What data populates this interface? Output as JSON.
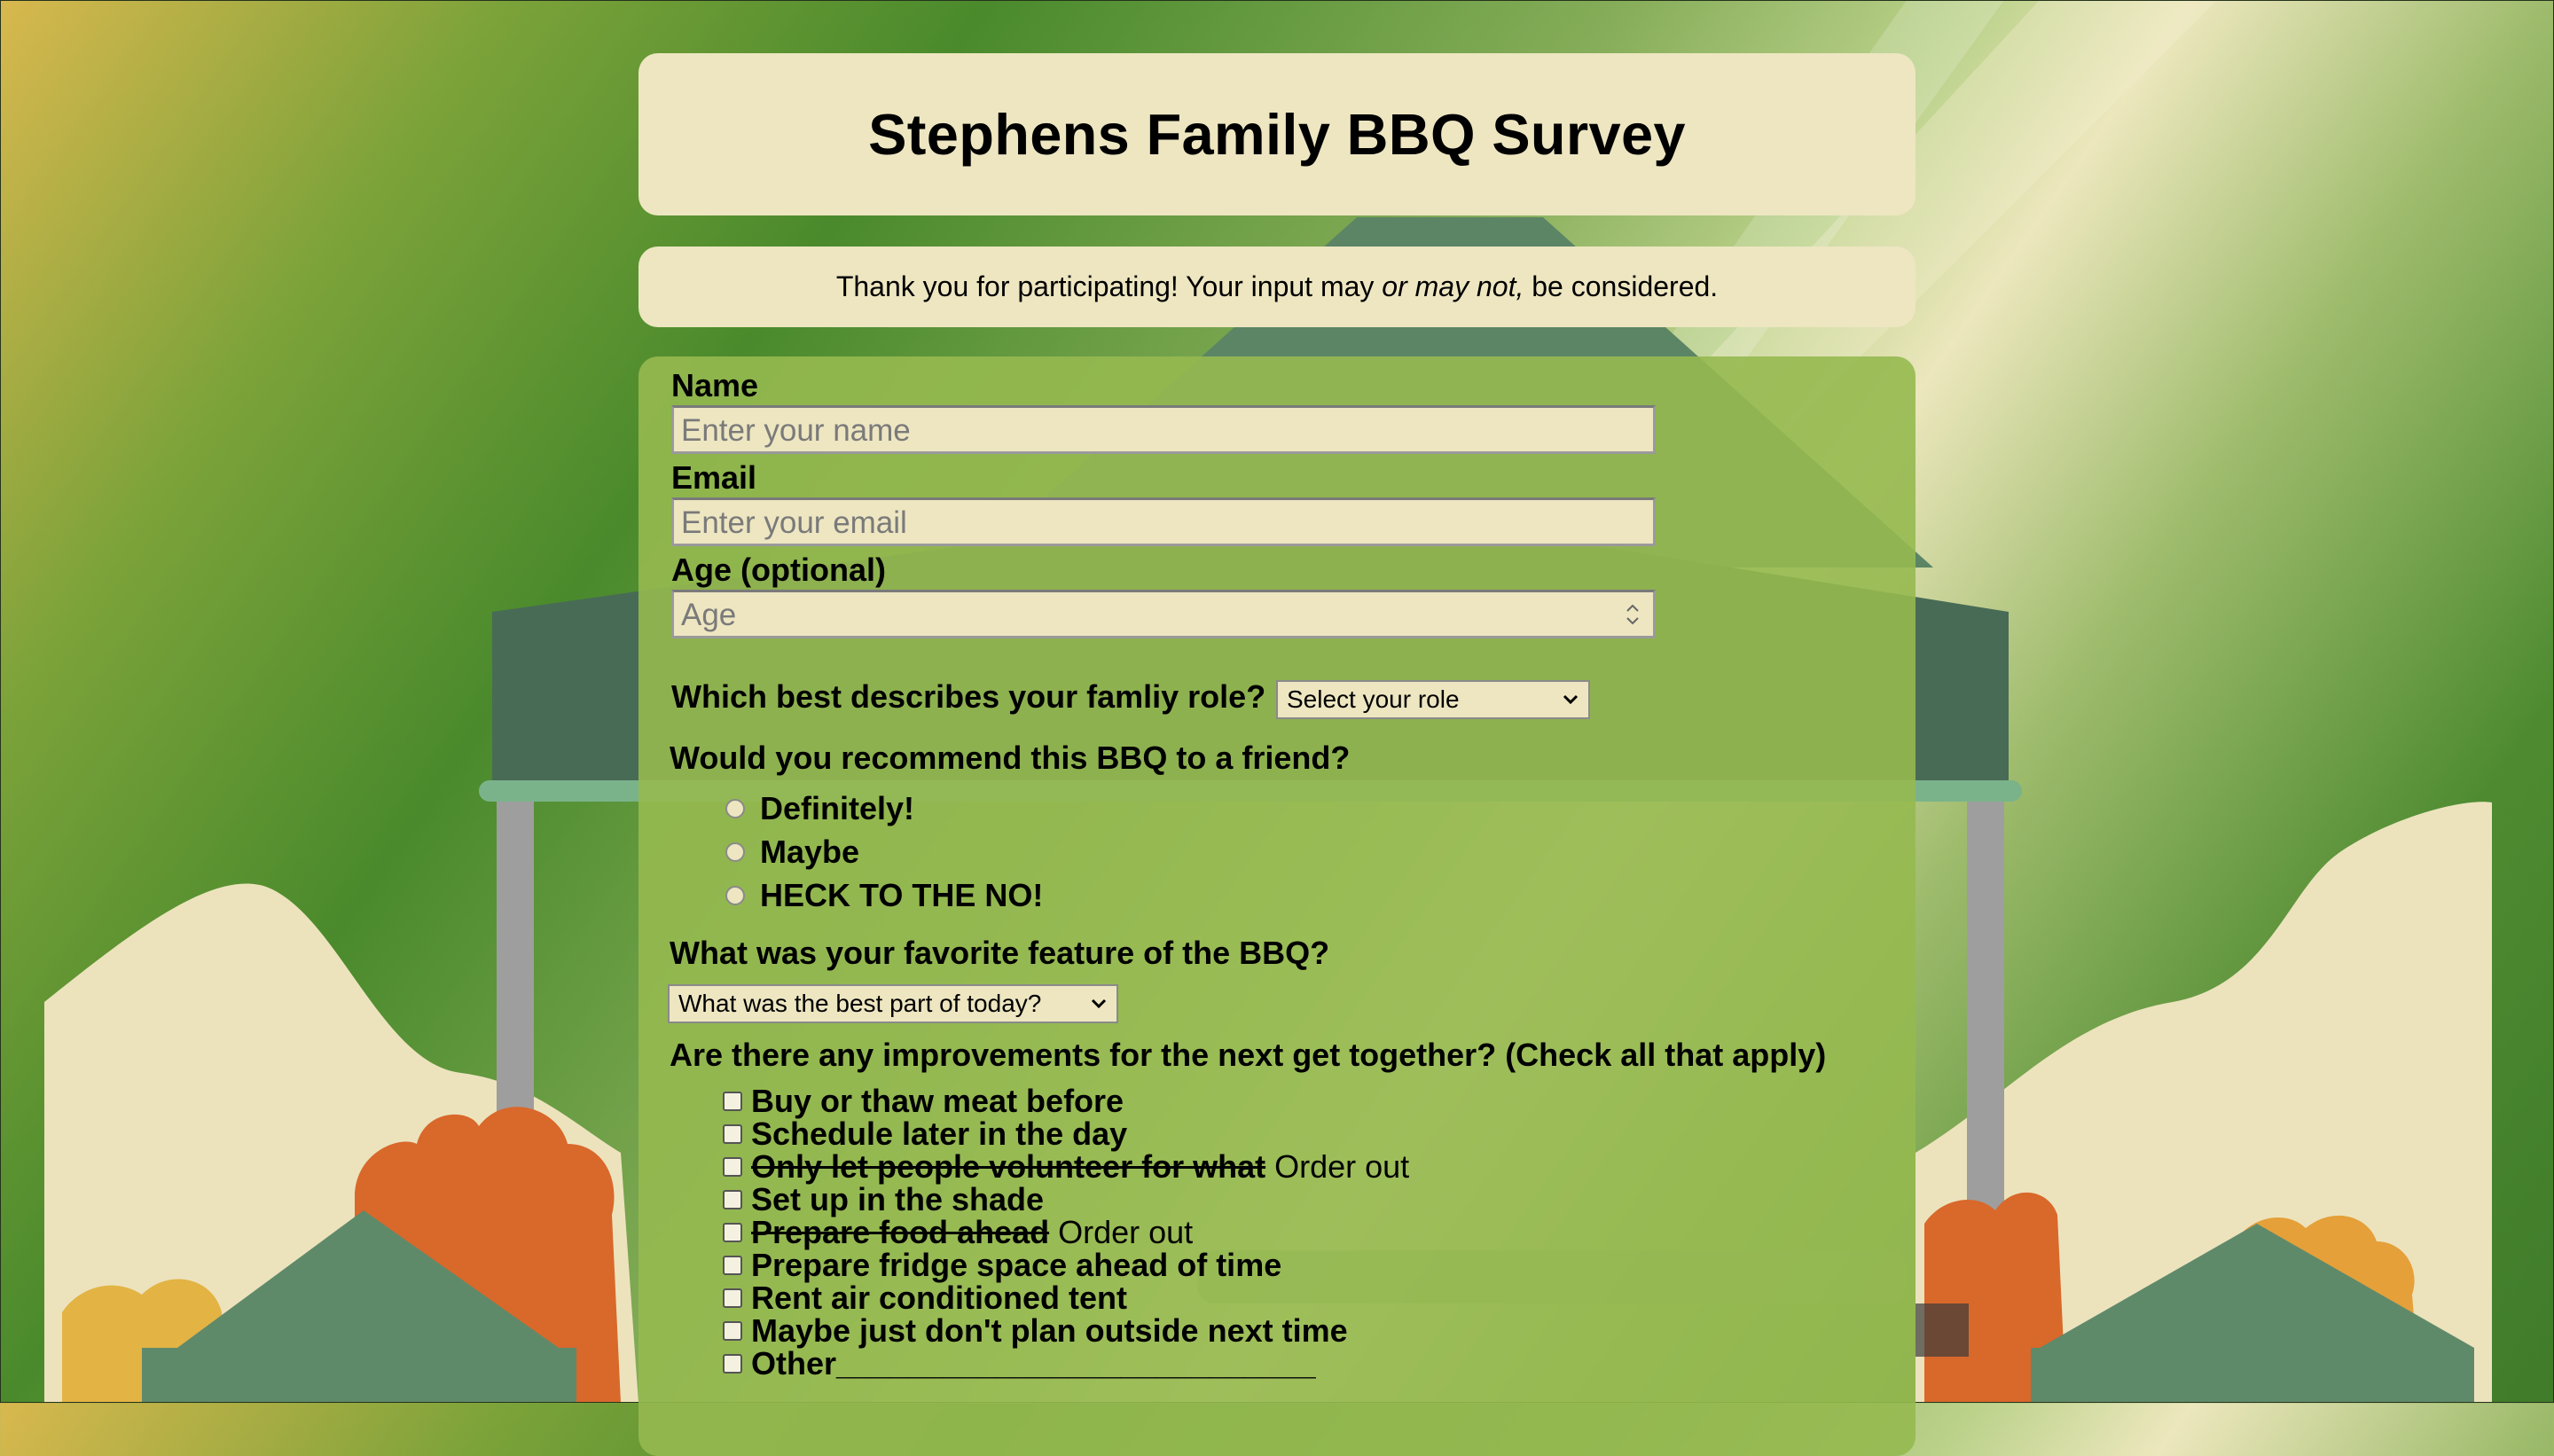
{
  "title": "Stephens Family BBQ Survey",
  "intro": {
    "before": "Thank you for participating! Your input may",
    "emphasis": "or may not,",
    "after": "be considered."
  },
  "form": {
    "name": {
      "label": "Name",
      "placeholder": "Enter your name"
    },
    "email": {
      "label": "Email",
      "placeholder": "Enter your email"
    },
    "age": {
      "label": "Age (optional)",
      "placeholder": "Age"
    },
    "role": {
      "question": "Which best describes your famliy role?",
      "selected": "Select your role"
    },
    "recommend": {
      "question": "Would you recommend this BBQ to a friend?",
      "options": [
        "Definitely!",
        "Maybe",
        "HECK TO THE NO!"
      ]
    },
    "favorite": {
      "question": "What was your favorite feature of the BBQ?",
      "selected": "What was the best part of today?"
    },
    "improvements": {
      "question": "Are there any improvements for the next get together? (Check all that apply)",
      "options": [
        {
          "label": "Buy or thaw meat before"
        },
        {
          "label": "Schedule later in the day"
        },
        {
          "struck": "Only let people volunteer for what",
          "tail": "Order out"
        },
        {
          "label": "Set up in the shade"
        },
        {
          "struck": "Prepare food ahead",
          "tail": "Order out"
        },
        {
          "label": "Prepare fridge space ahead of time"
        },
        {
          "label": "Rent air conditioned tent"
        },
        {
          "label": "Maybe just don't plan outside next time"
        },
        {
          "label": "Other___________________________"
        }
      ]
    }
  },
  "colors": {
    "panel_cream": "#ede6c1",
    "form_green": "#96b950",
    "tent_green": "#5f8a6a",
    "orange_bush": "#d9682b"
  }
}
